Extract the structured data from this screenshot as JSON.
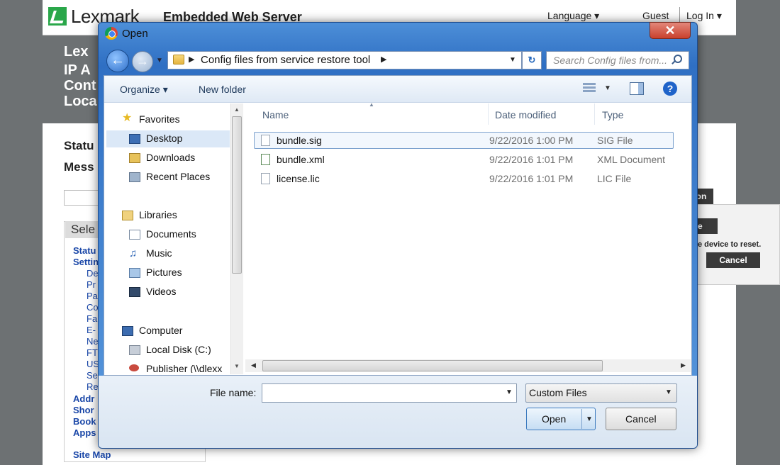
{
  "background": {
    "brand": "Lexmark",
    "server_title": "Embedded Web Server",
    "language": "Language ▾",
    "guest": "Guest",
    "login": "Log In ▾",
    "hero_lines": [
      "Lex",
      "IP A",
      "Cont",
      "Loca"
    ],
    "status_label": "Statu",
    "message_label": "Mess",
    "select_head": "Sele",
    "nav_links": [
      "Statu",
      "Settin"
    ],
    "nav_sub": [
      "De",
      "Pr",
      "Pa",
      "Co",
      "Fa",
      "E-",
      "Ne",
      "FT",
      "US",
      "Se",
      "Re"
    ],
    "nav_links_bottom": [
      "Addr",
      "Shor",
      "Book",
      "Apps"
    ],
    "site_map": "Site Map",
    "remote_btn_top": "on",
    "remote_btn_mid": "e",
    "reset_message": "e device to reset.",
    "remote_cancel": "Cancel"
  },
  "dialog": {
    "title": "Open",
    "close_glyph": "✕",
    "breadcrumb_folder": "Config files from service restore tool",
    "search_placeholder": "Search Config files from...",
    "toolbar": {
      "organize": "Organize ▾",
      "new_folder": "New folder",
      "help": "?"
    },
    "nav_pane": {
      "favorites": "Favorites",
      "desktop": "Desktop",
      "downloads": "Downloads",
      "recent": "Recent Places",
      "libraries": "Libraries",
      "documents": "Documents",
      "music": "Music",
      "pictures": "Pictures",
      "videos": "Videos",
      "computer": "Computer",
      "local_disk": "Local Disk (C:)",
      "publisher": "Publisher (\\\\dlexx"
    },
    "columns": {
      "name": "Name",
      "date": "Date modified",
      "type": "Type"
    },
    "files": [
      {
        "name": "bundle.sig",
        "date": "9/22/2016 1:00 PM",
        "type": "SIG File"
      },
      {
        "name": "bundle.xml",
        "date": "9/22/2016 1:01 PM",
        "type": "XML Document"
      },
      {
        "name": "license.lic",
        "date": "9/22/2016 1:01 PM",
        "type": "LIC File"
      }
    ],
    "filename_label": "File name:",
    "filename_value": "",
    "filetype": "Custom Files",
    "open_label": "Open",
    "cancel_label": "Cancel"
  }
}
